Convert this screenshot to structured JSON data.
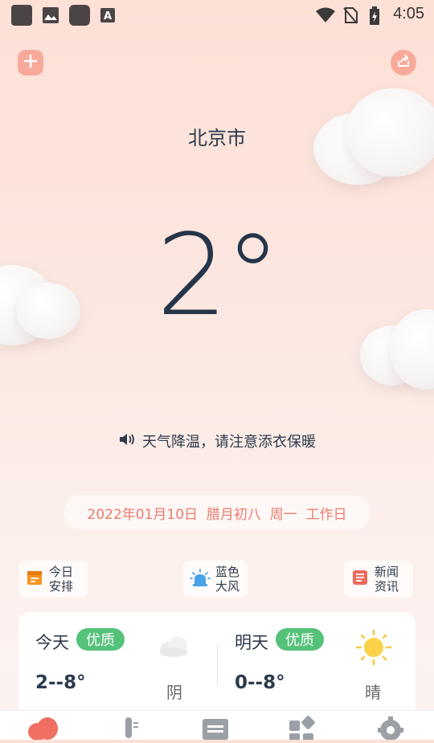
{
  "status_bar": {
    "time": "4:05"
  },
  "header": {
    "city": "北京市"
  },
  "current": {
    "temperature": "2°"
  },
  "notice": {
    "text": "天气降温，请注意添衣保暖"
  },
  "date_bar": {
    "text": "2022年01月10日  腊月初八  周一  工作日"
  },
  "chips": [
    {
      "line1": "今日",
      "line2": "安排",
      "icon": "calendar-icon"
    },
    {
      "line1": "蓝色",
      "line2": "大风",
      "icon": "siren-icon"
    },
    {
      "line1": "新闻",
      "line2": "资讯",
      "icon": "news-icon"
    }
  ],
  "forecast": {
    "today": {
      "label": "今天",
      "quality": "优质",
      "range": "2--8°",
      "condition": "阴"
    },
    "tomorrow": {
      "label": "明天",
      "quality": "优质",
      "range": "0--8°",
      "condition": "晴"
    }
  },
  "tabs": [
    {
      "name": "weather",
      "icon": "cloud-icon",
      "active": true
    },
    {
      "name": "temperature",
      "icon": "thermometer-icon",
      "active": false
    },
    {
      "name": "almanac",
      "icon": "calendar-book-icon",
      "active": false
    },
    {
      "name": "tools",
      "icon": "grid-icon",
      "active": false
    },
    {
      "name": "settings",
      "icon": "gear-icon",
      "active": false
    }
  ],
  "colors": {
    "accent": "#f8a99a",
    "badge": "#55c27a",
    "date_text": "#ee7b6e",
    "text": "#2c3a4d"
  }
}
